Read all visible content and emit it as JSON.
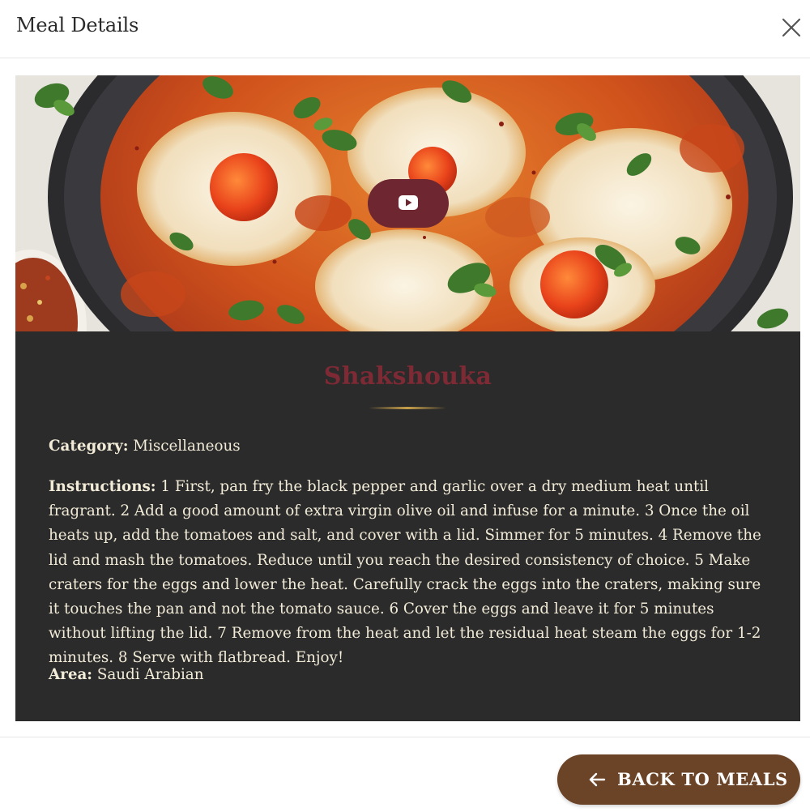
{
  "header": {
    "title": "Meal Details",
    "close_icon": "close-icon"
  },
  "hero": {
    "play_icon": "youtube-play-icon",
    "play_button_color": "#6e2630"
  },
  "meal": {
    "name": "Shakshouka",
    "category_label": "Category:",
    "category_value": " Miscellaneous",
    "instructions_label": "Instructions:",
    "instructions_value": " 1 First, pan fry the black pepper and garlic over a dry medium heat until fragrant. 2 Add a good amount of extra virgin olive oil and infuse for a minute. 3 Once the oil heats up, add the tomatoes and salt, and cover with a lid. Simmer for 5 minutes. 4 Remove the lid and mash the tomatoes. Reduce until you reach the desired consistency of choice. 5 Make craters for the eggs and lower the heat. Carefully crack the eggs into the craters, making sure it touches the pan and not the tomato sauce. 6 Cover the eggs and leave it for 5 minutes without lifting the lid. 7 Remove from the heat and let the residual heat steam the eggs for 1-2 minutes. 8 Serve with flatbread. Enjoy!",
    "area_label": "Area:",
    "area_value": " Saudi Arabian"
  },
  "footer": {
    "back_label": "BACK TO MEALS",
    "back_icon": "arrow-left-icon"
  },
  "colors": {
    "card_background": "#2b2b2b",
    "meal_name": "#7d2a35",
    "detail_text": "#f2ebd8",
    "divider_accent": "#c8a04a",
    "back_button": "#6b4327"
  }
}
